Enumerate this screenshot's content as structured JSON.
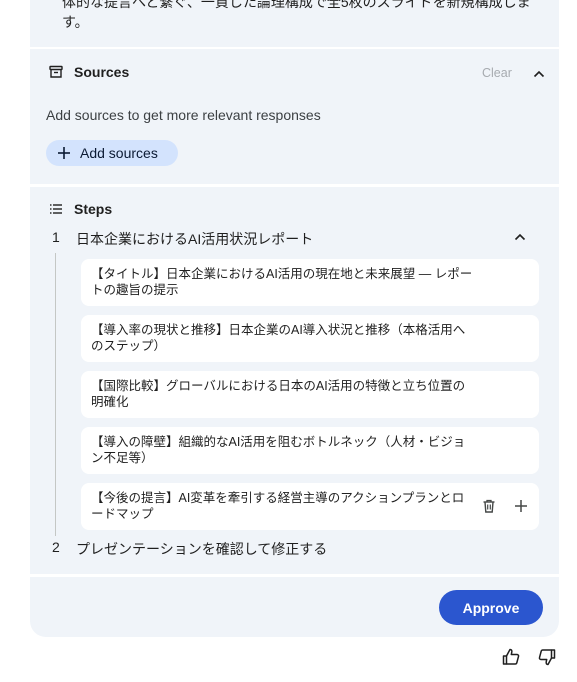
{
  "intro": {
    "text": "体的な提言へと繋ぐ、一貫した論理構成で全5枚のスライドを新規構成します。"
  },
  "sources": {
    "title": "Sources",
    "clear_label": "Clear",
    "note": "Add sources to get more relevant responses",
    "add_label": "Add sources"
  },
  "steps": {
    "title": "Steps",
    "items": [
      {
        "num": "1",
        "label": "日本企業におけるAI活用状況レポート",
        "subitems": [
          "【タイトル】日本企業におけるAI活用の現在地と未来展望 — レポートの趣旨の提示",
          "【導入率の現状と推移】日本企業のAI導入状況と推移（本格活用へのステップ）",
          "【国際比較】グローバルにおける日本のAI活用の特徴と立ち位置の明確化",
          "【導入の障壁】組織的なAI活用を阻むボトルネック（人材・ビジョン不足等）",
          "【今後の提言】AI変革を牽引する経営主導のアクションプランとロードマップ"
        ]
      },
      {
        "num": "2",
        "label": "プレゼンテーションを確認して修正する"
      }
    ]
  },
  "footer": {
    "approve_label": "Approve"
  },
  "icons": {
    "sources": "archive-box-icon",
    "steps": "list-icon",
    "collapse": "chevron-up-icon",
    "add": "plus-icon",
    "delete": "trash-icon",
    "thumbs_up": "thumbs-up-icon",
    "thumbs_down": "thumbs-down-icon"
  },
  "colors": {
    "panel_bg": "#f0f4f9",
    "add_button_bg": "#d3e3fd",
    "approve_bg": "#2b56cf"
  }
}
